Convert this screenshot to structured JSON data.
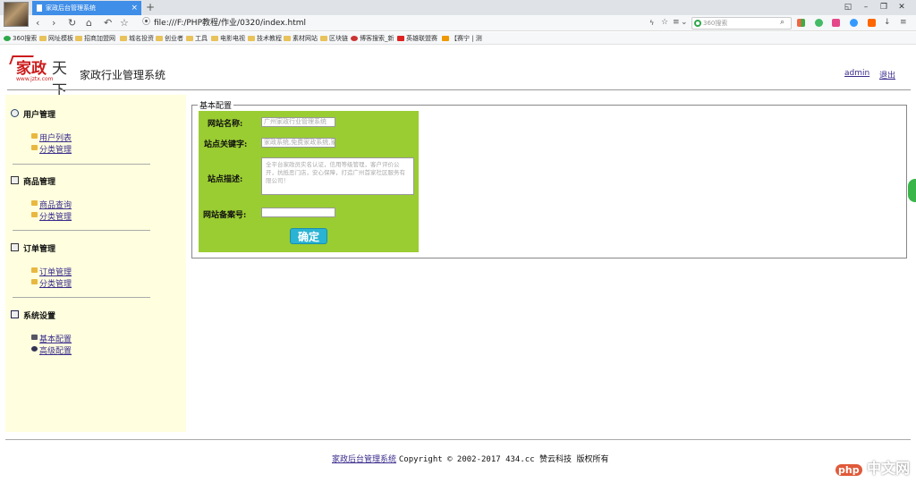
{
  "browser": {
    "tab_title": "家政后台管理系统",
    "tab_close": "×",
    "new_tab": "+",
    "url": "file:///F:/PHP教程/作业/0320/index.html",
    "search_placeholder": "360搜索",
    "window_controls": [
      "◱",
      "–",
      "❐",
      "✕"
    ],
    "nav_glyphs": [
      "‹",
      "›",
      "↻",
      "⌂",
      "↶",
      "☆"
    ],
    "bookmarks": [
      "360搜索",
      "网址模板",
      "招商加盟网",
      "城名投资",
      "创业者",
      "工具",
      "电影电视",
      "技术教程",
      "素材网站",
      "区块链",
      "博客搜索_新",
      "英雄联盟赛",
      "【赛宁 | 测"
    ]
  },
  "header": {
    "logo_text_a": "家政",
    "logo_text_b": "天下",
    "logo_url": "www.jztx.com",
    "system_title": "家政行业管理系统",
    "admin_link": "admin",
    "logout_link": "退出"
  },
  "sidebar": {
    "sections": [
      {
        "title": "用户管理",
        "items": [
          "用户列表",
          "分类管理"
        ]
      },
      {
        "title": "商品管理",
        "items": [
          "商品查询",
          "分类管理"
        ]
      },
      {
        "title": "订单管理",
        "items": [
          "订单管理",
          "分类管理"
        ]
      },
      {
        "title": "系统设置",
        "items": [
          "基本配置",
          "高级配置"
        ]
      }
    ]
  },
  "form": {
    "legend": "基本配置",
    "site_name_label": "网站名称:",
    "site_name_value": "广州家政行业管理系统",
    "keywords_label": "站点关键字:",
    "keywords_value": "家政系统,免费家政系统,家",
    "desc_label": "站点描述:",
    "desc_value": "全平台家政员实名认证，信用等级管理，客户评价公开，抗抵恶门店，安心保障，打造广州首家社区服务有限公司！",
    "icp_label": "网站备案号:",
    "icp_value": "",
    "submit_label": "确定"
  },
  "footer": {
    "link": "家政后台管理系统",
    "copyright": "Copyright  ©  2002-2017 434.cc 赞云科技 版权所有"
  },
  "watermark": {
    "a": "php",
    "b": "中文网"
  },
  "colors": {
    "tab_blue": "#3f8ee8",
    "sidebar_bg": "#ffffdf",
    "form_bg": "#9acd32",
    "button_bg": "#2ab3d3",
    "link": "#3a2c8c",
    "logo_red": "#cc1b1b"
  }
}
